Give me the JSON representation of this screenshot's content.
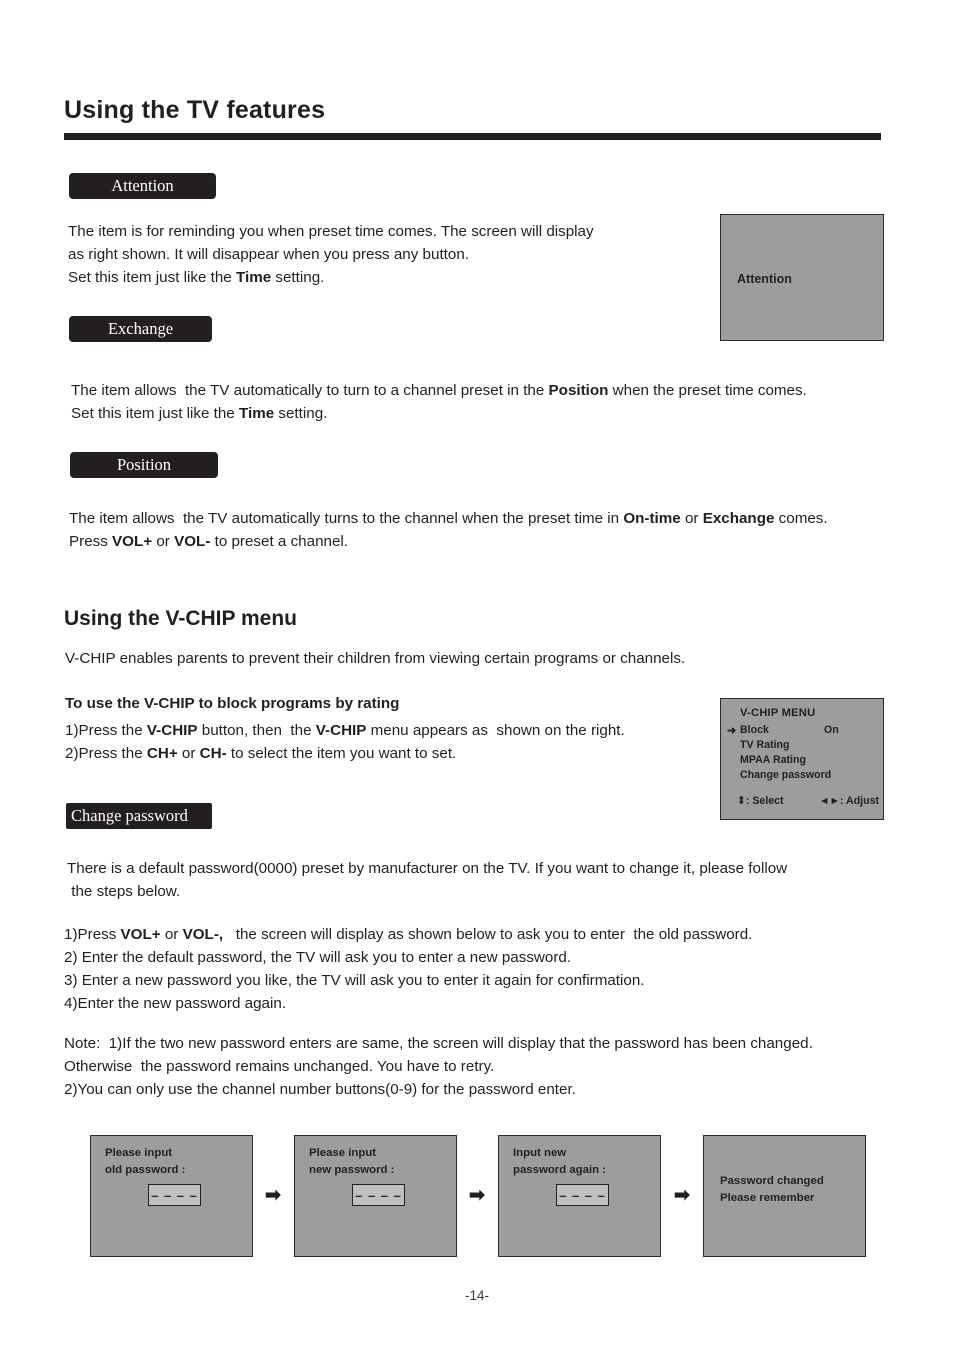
{
  "document": {
    "title": "Using the TV features",
    "page_number": "-14-"
  },
  "colors": {
    "ink": "#231f20",
    "screen_gray": "#9d9d9d",
    "field_gray": "#bfbfbf",
    "page_bg": "#ffffff"
  },
  "sections": {
    "attention": {
      "chip_label": "Attention",
      "body_lines": [
        "The item is for reminding you when preset time comes. The screen will display",
        "as right shown. It will disappear when you press any button.",
        "Set this item just like the <b>Time</b> setting."
      ],
      "screen": {
        "label": "Attention"
      }
    },
    "exchange": {
      "chip_label": "Exchange",
      "body_lines": [
        "The item allows  the TV automatically to turn to a channel preset in the <b>Position</b> when the preset time comes.",
        "Set this item just like the <b>Time</b> setting."
      ]
    },
    "position": {
      "chip_label": "Position",
      "body_lines": [
        "The item allows  the TV automatically turns to the channel when the preset time in <b>On-time</b> or <b>Exchange</b> comes.",
        "Press <b>VOL+</b> or <b>VOL-</b> to preset a channel."
      ]
    },
    "vchip": {
      "heading": "Using the V-CHIP menu",
      "intro": "V-CHIP enables parents to prevent their children from viewing certain programs or channels.",
      "howto_title": "To use the V-CHIP  to block programs by rating",
      "steps": [
        "1)Press the <b>V-CHIP</b> button, then  the <b>V-CHIP</b> menu appears as  shown on the right.",
        "2)Press the <b>CH+</b> or <b>CH-</b> to select the item you want to set."
      ],
      "menu": {
        "title": "V-CHIP MENU",
        "selected_index": 0,
        "selector_glyph": "➜",
        "items": [
          {
            "label": "Block",
            "value": "On"
          },
          {
            "label": "TV Rating",
            "value": ""
          },
          {
            "label": "MPAA Rating",
            "value": ""
          },
          {
            "label": "Change password",
            "value": ""
          }
        ],
        "footer": {
          "select_glyph": "⬍",
          "select_label": ": Select",
          "adjust_glyph": "◄►",
          "adjust_label": ": Adjust"
        }
      }
    },
    "change_password": {
      "chip_label": "Change password",
      "intro_lines": [
        "There is a default password(0000) preset by manufacturer on the TV. If you want to change it, please follow",
        " the steps below."
      ],
      "steps": [
        "1)Press <b>VOL+</b> or <b>VOL-,</b>   the screen will display as shown below to ask you to enter  the old password.",
        "2) Enter the default password, the TV will ask you to enter a new password.",
        "3) Enter a new password you like, the TV will ask you to enter it again for confirmation.",
        "4)Enter the new password again."
      ],
      "note_lines": [
        "Note:  1)If the two new password enters are same, the screen will display that the password has been changed.",
        "Otherwise  the password remains unchanged. You have to retry.",
        "2)You can only use the channel number buttons(0-9) for the password enter."
      ],
      "flow": {
        "arrow_glyph": "➡",
        "screens": [
          {
            "text": "Please input\nold password  :",
            "field_value": "– – – –",
            "has_field": true,
            "center": false
          },
          {
            "text": "Please input\nnew password  :",
            "field_value": "– – – –",
            "has_field": true,
            "center": false
          },
          {
            "text": "Input new\npassword again  :",
            "field_value": "– – – –",
            "has_field": true,
            "center": false
          },
          {
            "text": "Password changed\nPlease remember",
            "field_value": "",
            "has_field": false,
            "center": true
          }
        ]
      }
    }
  }
}
